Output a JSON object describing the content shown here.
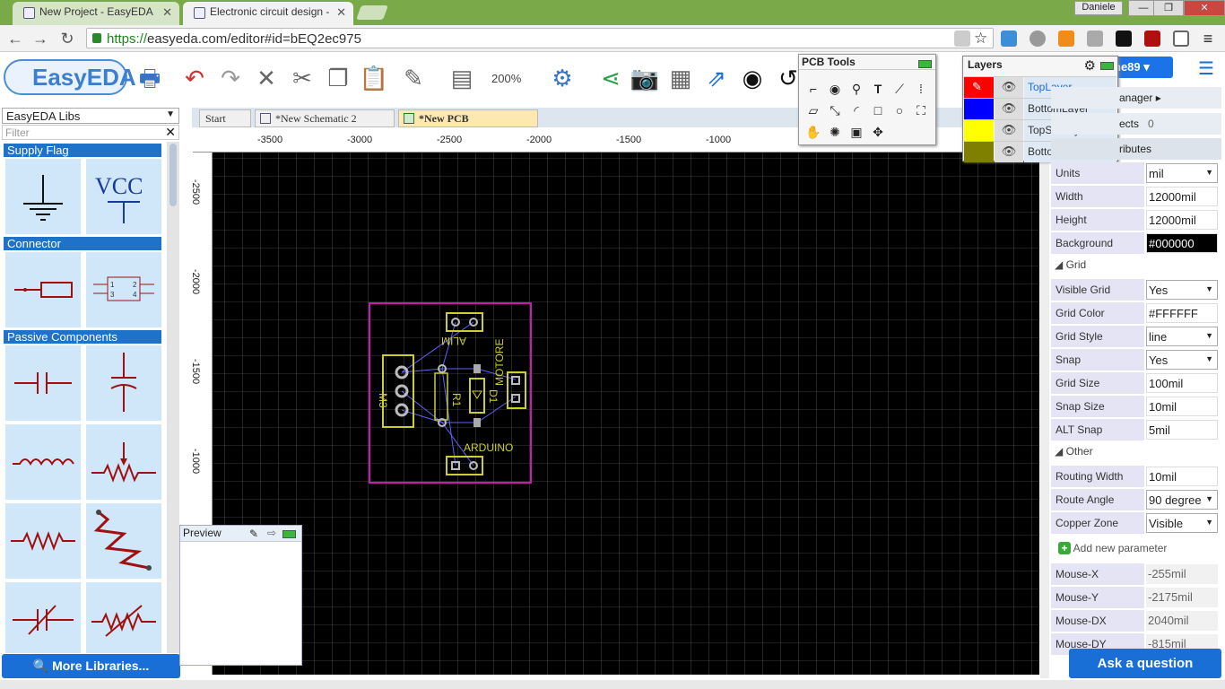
{
  "browser": {
    "tabs": [
      {
        "title": "New Project - EasyEDA"
      },
      {
        "title": "Electronic circuit design -"
      }
    ],
    "user": "Daniele",
    "url_scheme": "https://",
    "url_rest": "easyeda.com/editor#id=bEQ2ec975"
  },
  "app": {
    "logo_text": "EasyEDA",
    "zoom": "200%",
    "user_button": "ne89",
    "icons": [
      "printer-icon",
      "undo-icon",
      "redo-icon",
      "wire-tool-icon",
      "cut-icon",
      "copy-icon",
      "paste-icon",
      "format-painter-icon",
      "align-icon",
      "settings-gear-icon",
      "share-icon",
      "camera-icon",
      "bom-icon",
      "export-icon",
      "steam-icon",
      "history-icon"
    ]
  },
  "left_panel": {
    "library_select": "EasyEDA Libs",
    "filter_placeholder": "Filter",
    "categories": [
      "Supply Flag",
      "Connector",
      "Passive Components"
    ],
    "vcc_label": "VCC",
    "more_libraries": "More Libraries..."
  },
  "doc_tabs": [
    {
      "label": "Start"
    },
    {
      "label": "*New Schematic 2"
    },
    {
      "label": "*New PCB"
    }
  ],
  "ruler": {
    "top_ticks": [
      "-3500",
      "-3000",
      "-2500",
      "-2000",
      "-1500",
      "-1000"
    ],
    "left_ticks": [
      "-2500",
      "-2000",
      "-1500",
      "-1000"
    ]
  },
  "pcb": {
    "labels": {
      "m3": "M3",
      "alim": "ALIM",
      "motore": "MOTORE",
      "r1": "R1",
      "d1": "D1",
      "arduino": "ARDUINO"
    },
    "colors": {
      "board_outline": "#c51bb5",
      "silk": "#cccc33",
      "ratline": "#5b5bff",
      "grid": "#ffffff",
      "background": "#000000"
    }
  },
  "preview": {
    "title": "Preview"
  },
  "pcb_tools": {
    "title": "PCB Tools"
  },
  "layers": {
    "title": "Layers",
    "rows": [
      {
        "name": "TopLayer",
        "color": "#ff0000"
      },
      {
        "name": "BottomLayer",
        "color": "#0000ff"
      },
      {
        "name": "TopSilkLayer",
        "color": "#ffff00"
      },
      {
        "name": "BottomSilkLayer",
        "color": "#808000"
      }
    ]
  },
  "right_panel": {
    "partial_1": "anager ▸",
    "partial_2_label": "ects",
    "partial_2_value": "0",
    "partial_3": "ributes",
    "props": [
      {
        "label": "Units",
        "value": "mil"
      },
      {
        "label": "Width",
        "value": "12000mil"
      },
      {
        "label": "Height",
        "value": "12000mil"
      },
      {
        "label": "Background",
        "value": "#000000"
      }
    ],
    "grid_section": "Grid",
    "grid_props": [
      {
        "label": "Visible Grid",
        "value": "Yes"
      },
      {
        "label": "Grid Color",
        "value": "#FFFFFF"
      },
      {
        "label": "Grid Style",
        "value": "line"
      },
      {
        "label": "Snap",
        "value": "Yes"
      },
      {
        "label": "Grid Size",
        "value": "100mil"
      },
      {
        "label": "Snap Size",
        "value": "10mil"
      },
      {
        "label": "ALT Snap",
        "value": "5mil"
      }
    ],
    "other_section": "Other",
    "other_props": [
      {
        "label": "Routing Width",
        "value": "10mil"
      },
      {
        "label": "Route Angle",
        "value": "90 degree"
      },
      {
        "label": "Copper Zone",
        "value": "Visible"
      }
    ],
    "add_param": "Add new parameter",
    "mouse": [
      {
        "label": "Mouse-X",
        "value": "-255mil"
      },
      {
        "label": "Mouse-Y",
        "value": "-2175mil"
      },
      {
        "label": "Mouse-DX",
        "value": "2040mil"
      },
      {
        "label": "Mouse-DY",
        "value": "-815mil"
      }
    ],
    "ask": "Ask a question"
  }
}
